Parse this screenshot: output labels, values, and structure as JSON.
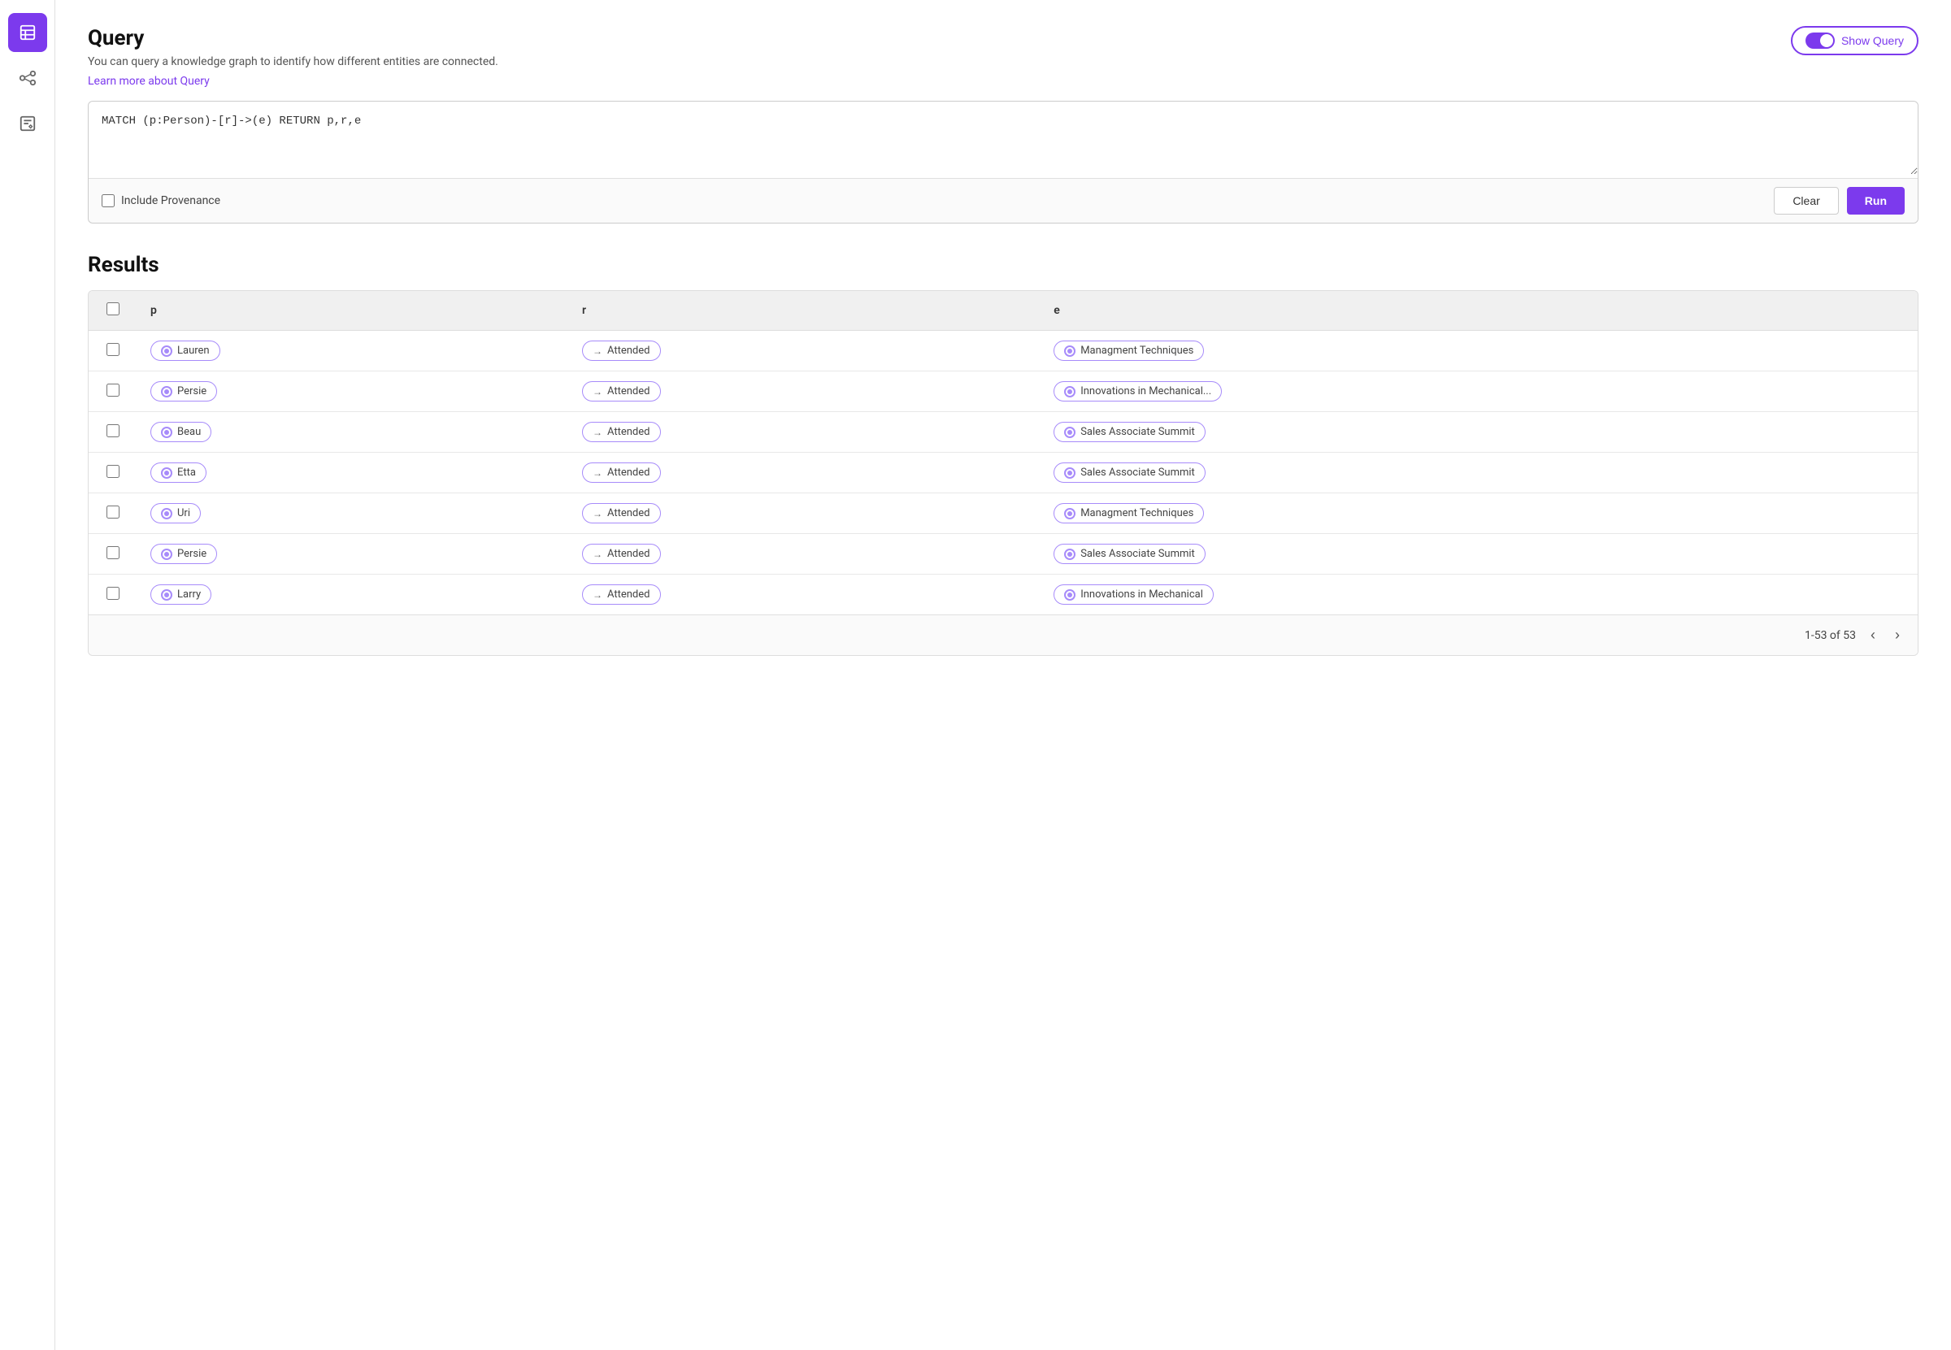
{
  "sidebar": {
    "items": [
      {
        "id": "table",
        "icon": "table-icon",
        "active": true
      },
      {
        "id": "graph",
        "icon": "graph-icon",
        "active": false
      },
      {
        "id": "edit",
        "icon": "edit-icon",
        "active": false
      }
    ]
  },
  "query": {
    "title": "Query",
    "subtitle": "You can query a knowledge graph to identify how different entities are connected.",
    "learn_link": "Learn more about Query",
    "show_query_label": "Show Query",
    "query_text": "MATCH (p:Person)-[r]->(e) RETURN p,r,e",
    "include_provenance_label": "Include Provenance",
    "clear_label": "Clear",
    "run_label": "Run"
  },
  "results": {
    "title": "Results",
    "pagination_info": "1-53 of 53",
    "columns": [
      {
        "key": "check",
        "label": ""
      },
      {
        "key": "p",
        "label": "p"
      },
      {
        "key": "r",
        "label": "r"
      },
      {
        "key": "e",
        "label": "e"
      }
    ],
    "rows": [
      {
        "p": "Lauren",
        "r": "Attended",
        "e": "Managment Techniques"
      },
      {
        "p": "Persie",
        "r": "Attended",
        "e": "Innovations in Mechanical..."
      },
      {
        "p": "Beau",
        "r": "Attended",
        "e": "Sales Associate Summit"
      },
      {
        "p": "Etta",
        "r": "Attended",
        "e": "Sales Associate Summit"
      },
      {
        "p": "Uri",
        "r": "Attended",
        "e": "Managment Techniques"
      },
      {
        "p": "Persie",
        "r": "Attended",
        "e": "Sales Associate Summit"
      },
      {
        "p": "Larry",
        "r": "Attended",
        "e": "Innovations in Mechanical"
      }
    ]
  }
}
